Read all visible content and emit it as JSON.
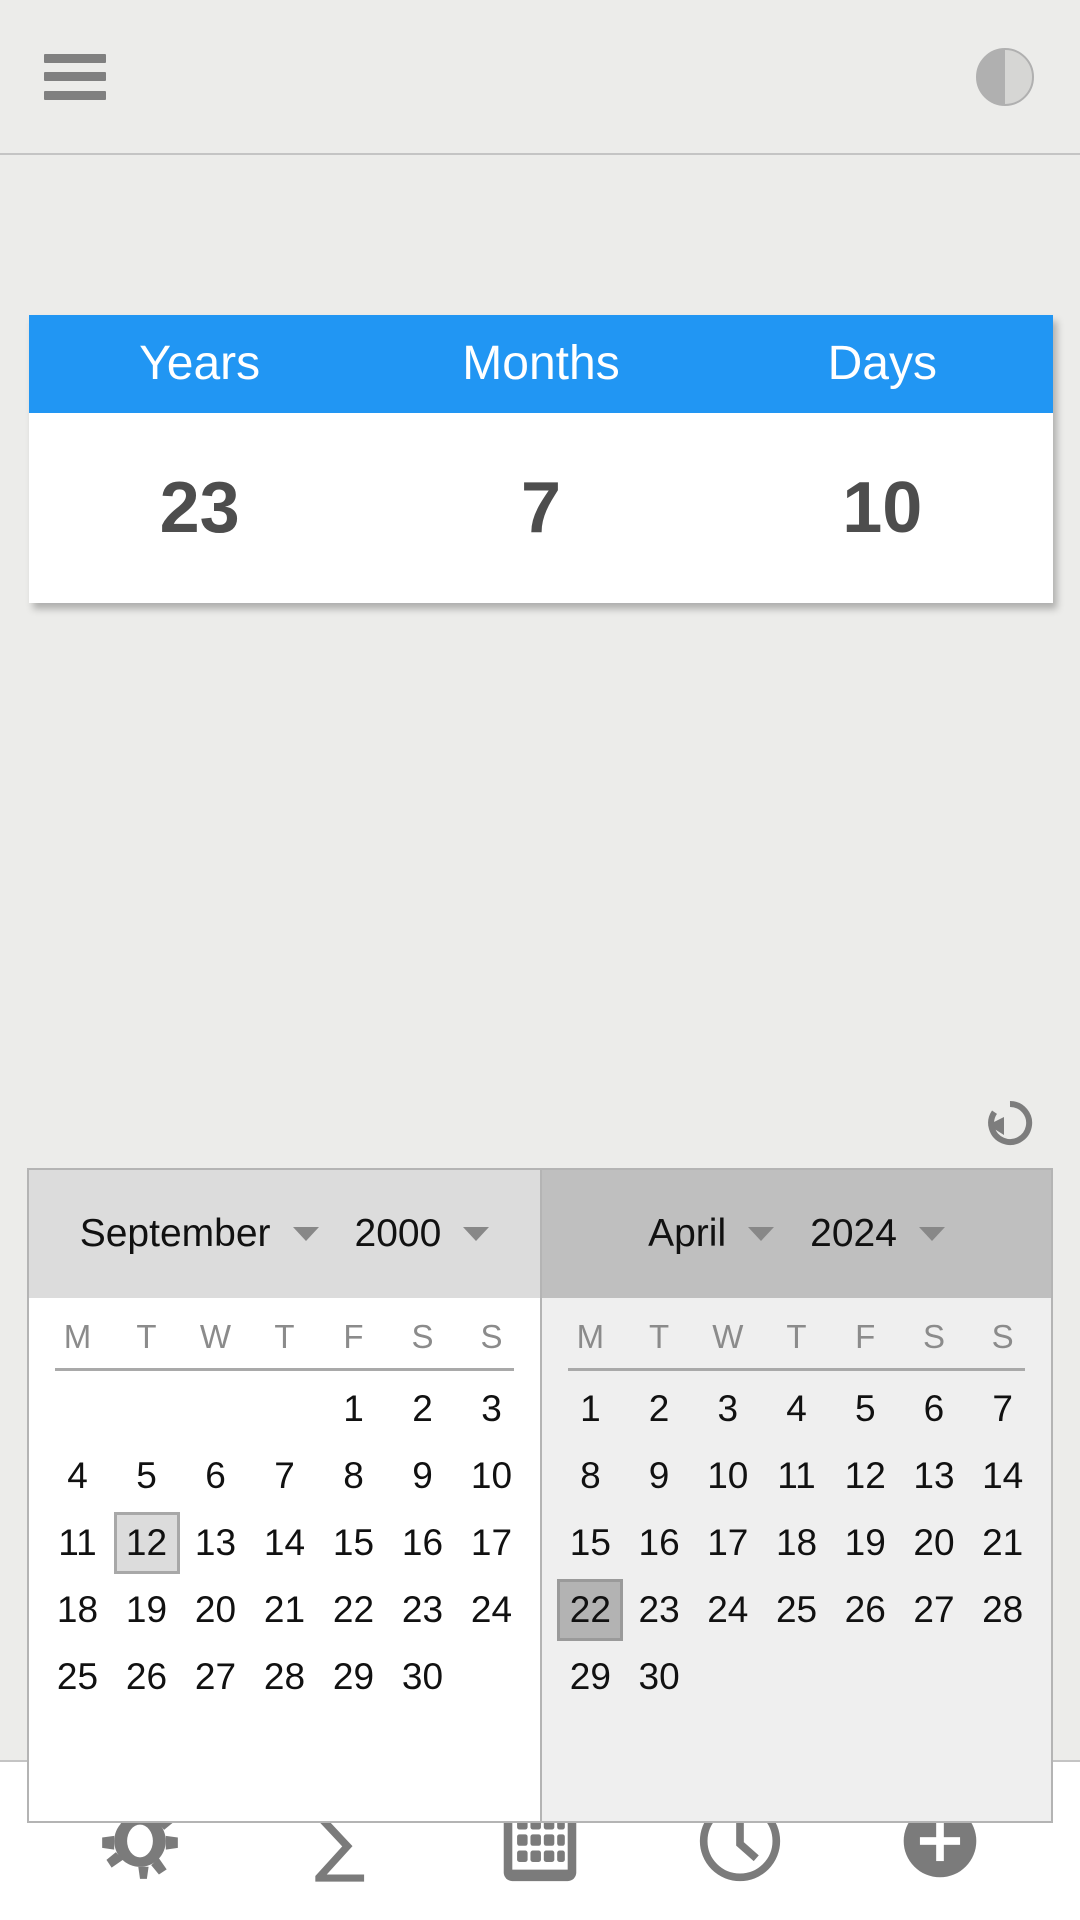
{
  "appbar": {
    "menu_icon": "hamburger-menu-icon",
    "theme_icon": "contrast-theme-icon"
  },
  "result": {
    "headers": [
      "Years",
      "Months",
      "Days"
    ],
    "values": [
      "23",
      "7",
      "10"
    ],
    "header_bg": "#2196f3",
    "value_color": "#4d4d4d"
  },
  "reset": {
    "icon": "refresh-reset-icon"
  },
  "calendars": [
    {
      "id": "start",
      "month": "September",
      "year": "2000",
      "weekdays": [
        "M",
        "T",
        "W",
        "T",
        "F",
        "S",
        "S"
      ],
      "selected_day": 12,
      "weeks": [
        [
          "",
          "",
          "",
          "",
          "1",
          "2",
          "3"
        ],
        [
          "4",
          "5",
          "6",
          "7",
          "8",
          "9",
          "10"
        ],
        [
          "11",
          "12",
          "13",
          "14",
          "15",
          "16",
          "17"
        ],
        [
          "18",
          "19",
          "20",
          "21",
          "22",
          "23",
          "24"
        ],
        [
          "25",
          "26",
          "27",
          "28",
          "29",
          "30",
          ""
        ]
      ]
    },
    {
      "id": "end",
      "month": "April",
      "year": "2024",
      "weekdays": [
        "M",
        "T",
        "W",
        "T",
        "F",
        "S",
        "S"
      ],
      "selected_day": 22,
      "weeks": [
        [
          "1",
          "2",
          "3",
          "4",
          "5",
          "6",
          "7"
        ],
        [
          "8",
          "9",
          "10",
          "11",
          "12",
          "13",
          "14"
        ],
        [
          "15",
          "16",
          "17",
          "18",
          "19",
          "20",
          "21"
        ],
        [
          "22",
          "23",
          "24",
          "25",
          "26",
          "27",
          "28"
        ],
        [
          "29",
          "30",
          "",
          "",
          "",
          "",
          ""
        ]
      ]
    }
  ],
  "toolbar": {
    "items": [
      {
        "icon": "gear-settings-icon"
      },
      {
        "icon": "sigma-sum-icon",
        "glyph": "∑"
      },
      {
        "icon": "calendar-grid-icon"
      },
      {
        "icon": "clock-icon"
      },
      {
        "icon": "add-plus-icon"
      }
    ]
  }
}
